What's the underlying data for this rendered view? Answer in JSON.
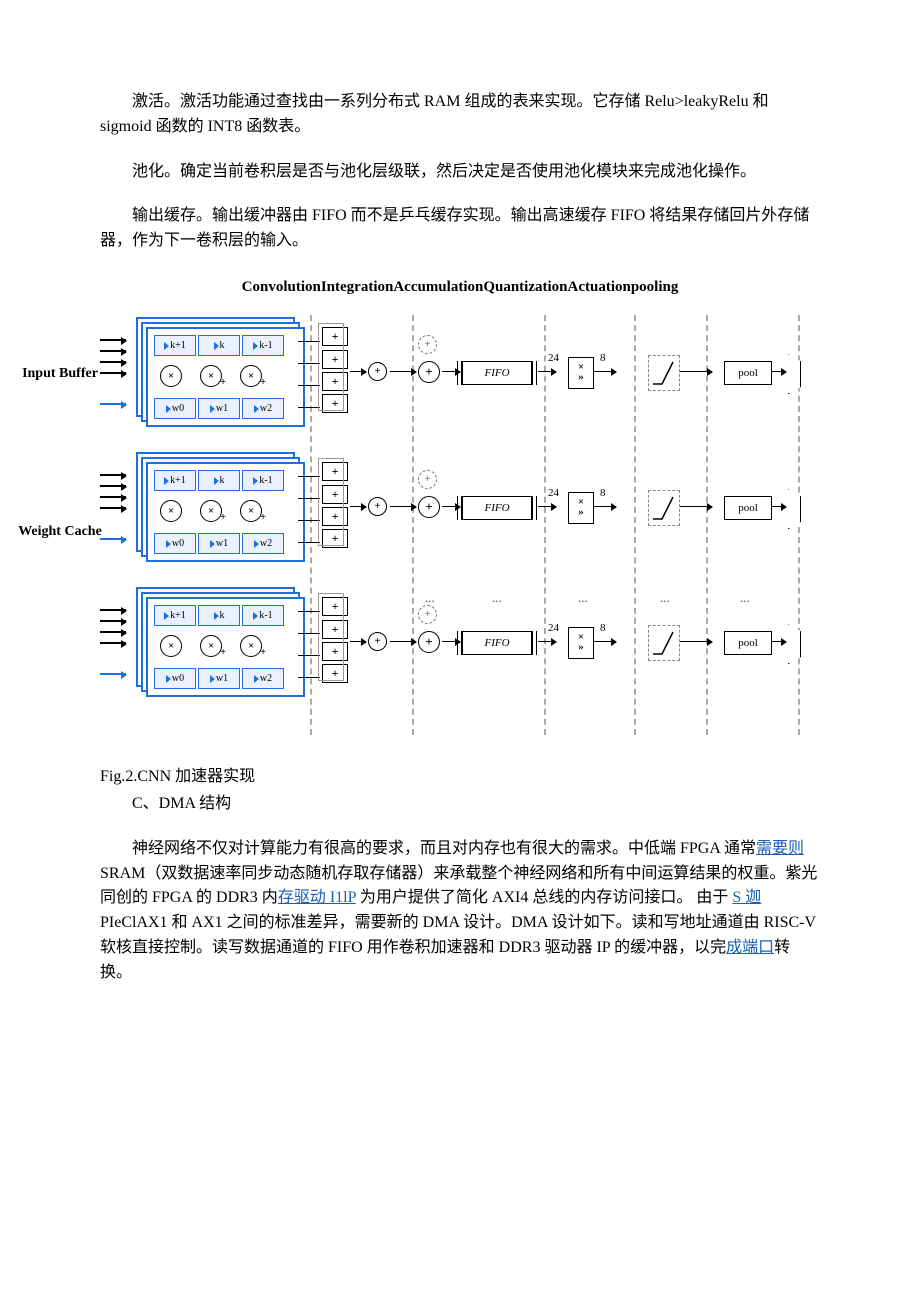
{
  "paragraphs": {
    "p1": "激活。激活功能通过查找由一系列分布式 RAM 组成的表来实现。它存储 Relu>leakyRelu 和 sigmoid 函数的 INT8 函数表。",
    "p2": "池化。确定当前卷积层是否与池化层级联，然后决定是否使用池化模块来完成池化操作。",
    "p3": "输出缓存。输出缓冲器由 FIFO 而不是乒乓缓存实现。输出高速缓存 FIFO 将结果存储回片外存储器，作为下一卷积层的输入。",
    "p4_a": "神经网络不仅对计算能力有很高的要求，而且对内存也有很大的需求。中低端 FPGA 通常",
    "p4_link1": "需要则",
    "p4_b": " SRAM（双数据速率同步动态随机存取存储器）来承载整个神经网络和所有中间运算结果的权重。紫光同创的 FPGA 的 DDR3 内",
    "p4_link2": "存驱动 I1lP",
    "p4_c": " 为用户提供了简化 AXI4 总线的内存访问接口。    由于 ",
    "p4_link3": "S 迦",
    "p4_d": " PIeClAX1 和 AX1 之间的标准差异，需要新的 DMA 设计。DMA 设计如下。读和写地址通道由 RISC-V 软核直接控制。读写数据通道的 FIFO 用作卷积加速器和 DDR3 驱动器 IP 的缓冲器，以完",
    "p4_link4": "成端口",
    "p4_e": "转换。"
  },
  "figure": {
    "heading": "ConvolutionIntegrationAccumulationQuantizationActuationpooling",
    "caption": "Fig.2.CNN 加速器实现",
    "subcaption": "C、DMA 结构",
    "side_input": "Input Buffer",
    "side_weight": "Weight Cache",
    "k_labels": [
      "k+1",
      "k",
      "k-1"
    ],
    "w_labels": [
      "w0",
      "w1",
      "w2"
    ],
    "fifo_label": "FIFO",
    "quant_in": "24",
    "quant_out": "8",
    "pool_label": "pool",
    "plus": "+",
    "mult": "×",
    "shift": "»"
  },
  "chart_data": {
    "type": "diagram",
    "title": "CNN accelerator pipeline (3 parallel lanes)",
    "stages": [
      "Convolution",
      "Integration",
      "Accumulation",
      "Quantization",
      "Actuation",
      "pooling"
    ],
    "left_inputs": [
      "Input Buffer",
      "Weight Cache"
    ],
    "lanes": 3,
    "lane": {
      "convolution": {
        "stacked_cards": 3,
        "top_row_registers": [
          "k+1",
          "k",
          "k-1"
        ],
        "bottom_row_weights": [
          "w0",
          "w1",
          "w2"
        ],
        "multipliers": 3,
        "note": "last two multipliers also accumulate (×+)"
      },
      "integration": {
        "adder_tree_inputs": 4,
        "reducers": [
          "+",
          "+",
          "+",
          "+",
          "+"
        ]
      },
      "accumulation": {
        "accumulator": "⊕ (feedback adder)",
        "buffer": "FIFO"
      },
      "quantization": {
        "input_bits": 24,
        "output_bits": 8,
        "ops": [
          "×",
          "»"
        ]
      },
      "actuation": {
        "function": "piecewise / LUT activation"
      },
      "pooling": {
        "block": "pool",
        "output": "mux to off-chip"
      }
    }
  }
}
